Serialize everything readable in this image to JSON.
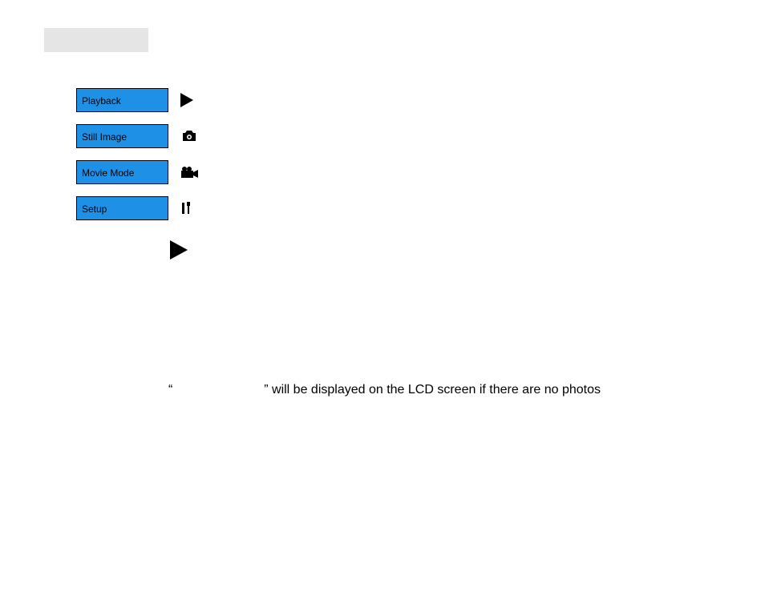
{
  "menu": {
    "playback": "Playback",
    "still_image": "Still Image",
    "movie_mode": "Movie Mode",
    "setup": "Setup"
  },
  "note": {
    "quote_open": "“",
    "quote_close": "” will be displayed on the LCD screen if there are no photos"
  }
}
